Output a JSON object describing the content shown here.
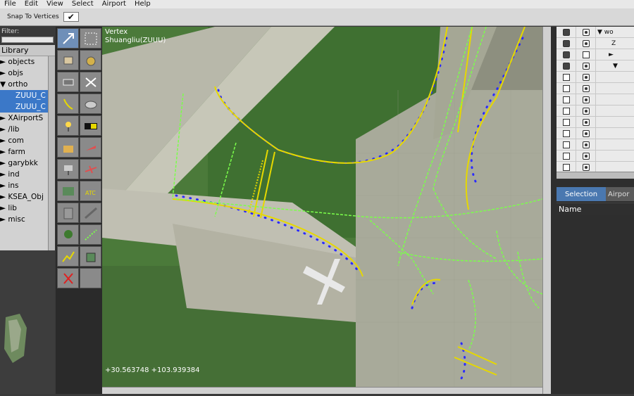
{
  "menu": [
    "File",
    "Edit",
    "View",
    "Select",
    "Airport",
    "Help"
  ],
  "toolbar": {
    "snap_label": "Snap To Vertices",
    "snap_checked": "✔"
  },
  "left": {
    "filter_label": "Filter:",
    "library_label": "Library",
    "items": [
      "► objects",
      "► objs",
      "▼ ortho",
      "ZUUU_C",
      "ZUUU_C",
      "► XAirportS",
      "► /lib",
      "► com",
      "► farm",
      "► garybkk",
      "► ind",
      "► ins",
      "► KSEA_Obj",
      "► lib",
      "► misc"
    ]
  },
  "map": {
    "mode": "Vertex",
    "airport": "Shuangliu(ZUUU)",
    "coords": "+30.563748 +103.939384"
  },
  "right": {
    "rows": [
      {
        "label": "▼ wo"
      },
      {
        "label": "Z"
      },
      {
        "label": "►"
      },
      {
        "label": "▼"
      },
      {
        "label": ""
      },
      {
        "label": ""
      },
      {
        "label": ""
      },
      {
        "label": ""
      },
      {
        "label": ""
      },
      {
        "label": ""
      },
      {
        "label": ""
      },
      {
        "label": ""
      },
      {
        "label": ""
      }
    ],
    "tab_selection": "Selection",
    "tab_airport": "Airpor",
    "name_header": "Name"
  },
  "colors": {
    "taxi_line": "#e6d800",
    "green_line": "#7bff4a",
    "edge_dot": "#2b2bff",
    "selected": "#3b78c8"
  }
}
